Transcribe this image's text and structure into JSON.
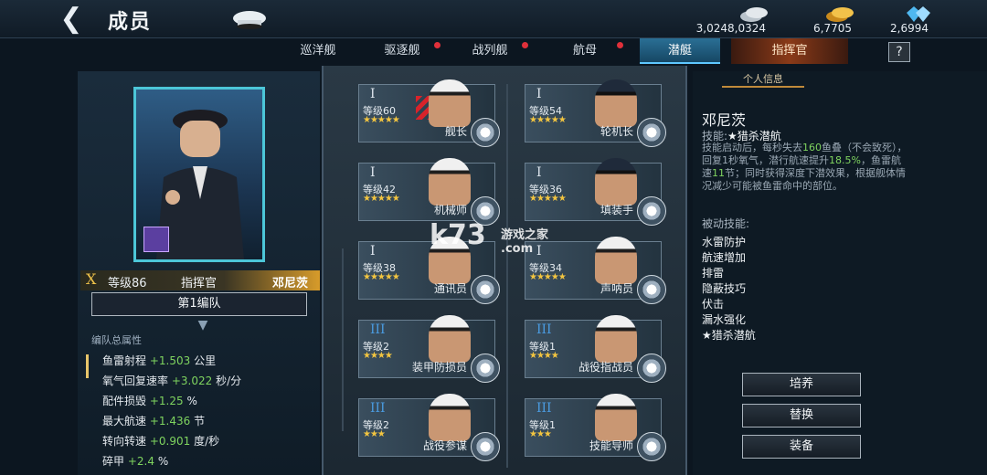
{
  "header": {
    "back_label": "❮",
    "title": "成员",
    "resources": [
      {
        "icon": "silver-coins-icon",
        "value": "3,0248,0324"
      },
      {
        "icon": "gold-coins-icon",
        "value": "6,7705"
      },
      {
        "icon": "diamond-icon",
        "value": "2,6994"
      }
    ]
  },
  "tabs": [
    {
      "label": "巡洋舰",
      "dot": false,
      "active": false
    },
    {
      "label": "驱逐舰",
      "dot": true,
      "active": false
    },
    {
      "label": "战列舰",
      "dot": true,
      "active": false
    },
    {
      "label": "航母",
      "dot": true,
      "active": false
    },
    {
      "label": "潜艇",
      "dot": false,
      "active": true
    },
    {
      "label": "指挥官",
      "dot": false,
      "active": false
    }
  ],
  "help_label": "?",
  "commander": {
    "rank": "X",
    "level": "等级86",
    "role": "指挥官",
    "name": "邓尼茨",
    "fleet": "第1编队"
  },
  "stats": {
    "title": "编队总属性",
    "items": [
      {
        "label": "鱼雷射程",
        "value": "+1.503",
        "unit": "公里"
      },
      {
        "label": "氧气回复速率",
        "value": "+3.022",
        "unit": "秒/分"
      },
      {
        "label": "配件损毁",
        "value": "+1.25",
        "unit": "%"
      },
      {
        "label": "最大航速",
        "value": "+1.436",
        "unit": "节"
      },
      {
        "label": "转向转速",
        "value": "+0.901",
        "unit": "度/秒"
      },
      {
        "label": "碎甲",
        "value": "+2.4",
        "unit": "%"
      }
    ]
  },
  "crew": [
    {
      "rank": "I",
      "level": "等级60",
      "stars": "★★★★★",
      "role": "舰长",
      "blue": false
    },
    {
      "rank": "I",
      "level": "等级54",
      "stars": "★★★★★",
      "role": "轮机长",
      "blue": false
    },
    {
      "rank": "I",
      "level": "等级42",
      "stars": "★★★★★",
      "role": "机械师",
      "blue": false
    },
    {
      "rank": "I",
      "level": "等级36",
      "stars": "★★★★★",
      "role": "填装手",
      "blue": false
    },
    {
      "rank": "I",
      "level": "等级38",
      "stars": "★★★★★",
      "role": "通讯员",
      "blue": false
    },
    {
      "rank": "I",
      "level": "等级34",
      "stars": "★★★★★",
      "role": "声呐员",
      "blue": false
    },
    {
      "rank": "III",
      "level": "等级2",
      "stars": "★★★★",
      "role": "装甲防损员",
      "blue": true
    },
    {
      "rank": "III",
      "level": "等级1",
      "stars": "★★★★",
      "role": "战役指战员",
      "blue": true
    },
    {
      "rank": "III",
      "level": "等级2",
      "stars": "★★★",
      "role": "战役参谋",
      "blue": true
    },
    {
      "rank": "III",
      "level": "等级1",
      "stars": "★★★",
      "role": "技能导师",
      "blue": true
    }
  ],
  "watermark": {
    "main": "k73",
    "sub": "游戏之家",
    "domain": ".com"
  },
  "detail": {
    "tab": "个人信息",
    "name": "邓尼茨",
    "skill_label": "技能:",
    "skill_name": "★猎杀潜航",
    "skill_desc_1": "技能启动后，每秒失去",
    "skill_desc_g1": "160",
    "skill_desc_2": "鱼叠（不会致死），回复1秒氧气，潜行航速提升",
    "skill_desc_g2": "18.5%",
    "skill_desc_3": "，鱼雷航速",
    "skill_desc_g3": "11",
    "skill_desc_4": "节；同时获得深度下潜效果，根据舰体情况减少可能被鱼雷命中的部位。",
    "passive_title": "被动技能:",
    "passives": [
      "水雷防护",
      "航速增加",
      "排雷",
      "隐蔽技巧",
      "伏击",
      "漏水强化",
      "★猎杀潜航"
    ],
    "buttons": [
      "培养",
      "替换",
      "装备"
    ]
  }
}
